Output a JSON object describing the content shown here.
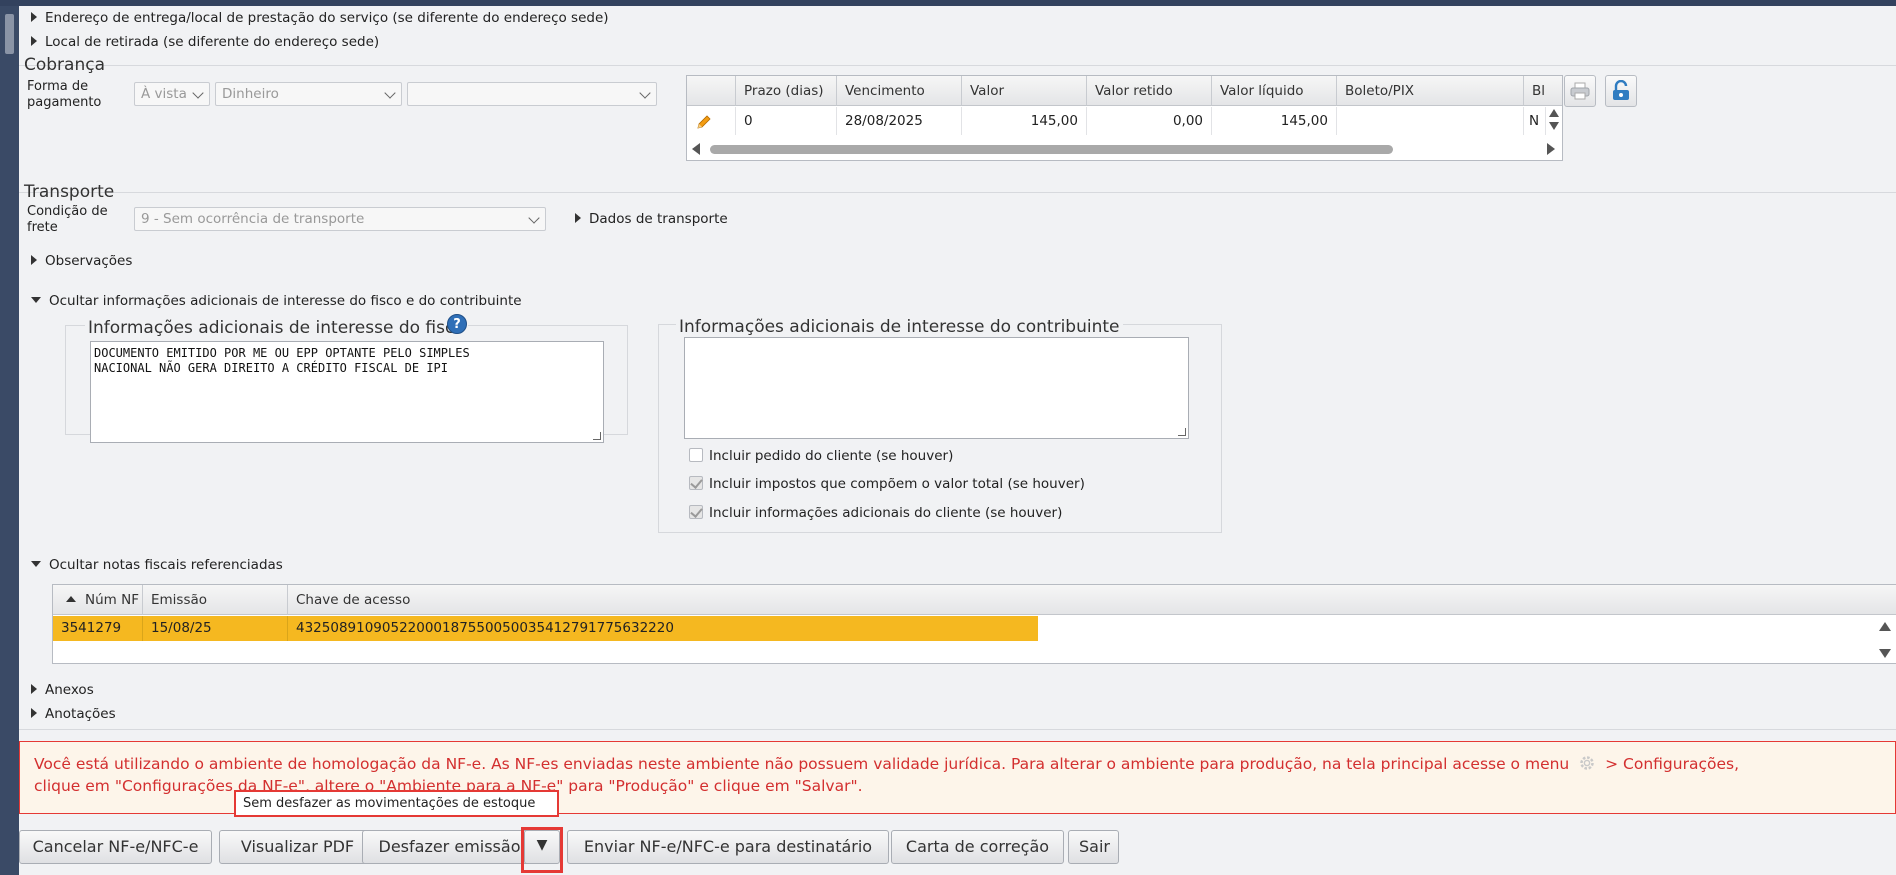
{
  "expanders": {
    "endereco_entrega": "Endereço de entrega/local de prestação do serviço (se diferente do endereço sede)",
    "local_retirada": "Local de retirada (se diferente do endereço sede)",
    "dados_transporte": "Dados de transporte",
    "observacoes": "Observações",
    "ocultar_info_adicionais": "Ocultar informações adicionais de interesse do fisco e do contribuinte",
    "ocultar_notas_ref": "Ocultar notas fiscais referenciadas",
    "anexos": "Anexos",
    "anotacoes": "Anotações"
  },
  "cobranca": {
    "title": "Cobrança",
    "forma_label": "Forma de pagamento",
    "condicao_value": "À vista",
    "meio_value": "Dinheiro",
    "extra_value": "",
    "columns": [
      "Prazo (dias)",
      "Vencimento",
      "Valor",
      "Valor retido",
      "Valor líquido",
      "Boleto/PIX",
      "Bl"
    ],
    "rows": [
      {
        "prazo": "0",
        "vencimento": "28/08/2025",
        "valor": "145,00",
        "valor_retido": "0,00",
        "valor_liquido": "145,00",
        "boleto": "",
        "bl": "N"
      }
    ]
  },
  "transporte": {
    "title": "Transporte",
    "condicao_label": "Condição de frete",
    "condicao_value": "9 - Sem ocorrência de transporte"
  },
  "info_fisco": {
    "title": "Informações adicionais de interesse do fisco",
    "text": "DOCUMENTO EMITIDO POR ME OU EPP OPTANTE PELO SIMPLES\nNACIONAL NÃO GERA DIREITO A CRÉDITO FISCAL DE IPI"
  },
  "info_contribuinte": {
    "title": "Informações adicionais de interesse do contribuinte",
    "text": "",
    "checkboxes": [
      {
        "label": "Incluir pedido do cliente (se houver)",
        "checked": false
      },
      {
        "label": "Incluir impostos que compõem o valor total (se houver)",
        "checked": true
      },
      {
        "label": "Incluir informações adicionais do cliente (se houver)",
        "checked": true
      }
    ]
  },
  "notas_ref": {
    "columns": [
      "Núm NF",
      "Emissão",
      "Chave de acesso"
    ],
    "rows": [
      {
        "num": "3541279",
        "emissao": "15/08/25",
        "chave": "43250891090522000187550050035412791775632220"
      }
    ]
  },
  "warning": {
    "text_part1": "Você está utilizando o ambiente de homologação da NF-e. As NF-es enviadas neste ambiente não possuem validade jurídica. Para alterar o ambiente para produção, na tela principal acesse o menu",
    "text_part2": "> Configurações,",
    "text_line2": "clique em \"Configurações da NF-e\", altere o \"Ambiente para a NF-e\" para \"Produção\" e clique em \"Salvar\"."
  },
  "popup": {
    "label": "Sem desfazer as movimentações de estoque"
  },
  "buttons": {
    "cancelar": "Cancelar NF-e/NFC-e",
    "visualizar": "Visualizar PDF",
    "desfazer": "Desfazer emissão",
    "enviar": "Enviar NF-e/NFC-e para destinatário",
    "carta": "Carta de correção",
    "sair": "Sair"
  },
  "colors": {
    "accent_row": "#f5b820",
    "warning_red": "#d32f2f",
    "highlight_border": "#e53935"
  }
}
